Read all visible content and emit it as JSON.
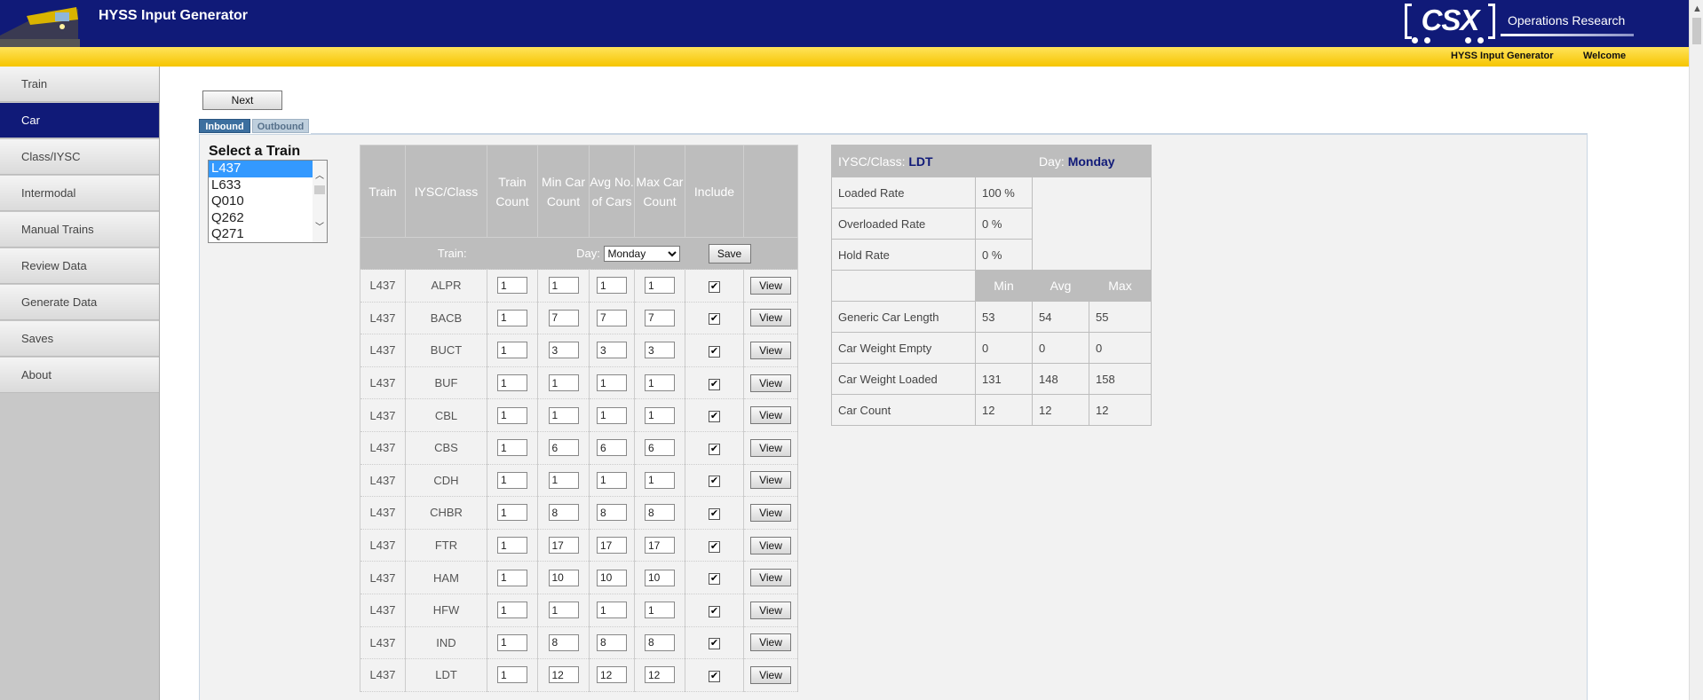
{
  "header": {
    "app_title": "HYSS Input Generator",
    "brand": "CSX",
    "org": "Operations Research",
    "links": [
      "HYSS Input Generator",
      "Welcome"
    ],
    "colors": {
      "header_bg": "#101a78",
      "bar": "#f6c500"
    }
  },
  "sidebar": {
    "items": [
      {
        "label": "Train",
        "active": false
      },
      {
        "label": "Car",
        "active": true
      },
      {
        "label": "Class/IYSC",
        "active": false
      },
      {
        "label": "Intermodal",
        "active": false
      },
      {
        "label": "Manual Trains",
        "active": false
      },
      {
        "label": "Review Data",
        "active": false
      },
      {
        "label": "Generate Data",
        "active": false
      },
      {
        "label": "Saves",
        "active": false
      },
      {
        "label": "About",
        "active": false
      }
    ]
  },
  "main": {
    "next_label": "Next",
    "tabs": [
      {
        "label": "Inbound",
        "active": true
      },
      {
        "label": "Outbound",
        "active": false
      }
    ],
    "select_train_label": "Select a Train",
    "trains": [
      "L437",
      "L633",
      "Q010",
      "Q262",
      "Q271"
    ],
    "selected_train": "L437"
  },
  "car_table": {
    "train_label": "Train:",
    "day_label": "Day:",
    "day_value": "Monday",
    "save_label": "Save",
    "headers": [
      "Train",
      "IYSC/Class",
      "Train Count",
      "Min Car Count",
      "Avg No. of Cars",
      "Max Car Count",
      "Include",
      ""
    ],
    "view_label": "View",
    "rows": [
      {
        "train": "L437",
        "cls": "ALPR",
        "tc": "1",
        "min": "1",
        "avg": "1",
        "max": "1",
        "include": true
      },
      {
        "train": "L437",
        "cls": "BACB",
        "tc": "1",
        "min": "7",
        "avg": "7",
        "max": "7",
        "include": true
      },
      {
        "train": "L437",
        "cls": "BUCT",
        "tc": "1",
        "min": "3",
        "avg": "3",
        "max": "3",
        "include": true
      },
      {
        "train": "L437",
        "cls": "BUF",
        "tc": "1",
        "min": "1",
        "avg": "1",
        "max": "1",
        "include": true
      },
      {
        "train": "L437",
        "cls": "CBL",
        "tc": "1",
        "min": "1",
        "avg": "1",
        "max": "1",
        "include": true
      },
      {
        "train": "L437",
        "cls": "CBS",
        "tc": "1",
        "min": "6",
        "avg": "6",
        "max": "6",
        "include": true
      },
      {
        "train": "L437",
        "cls": "CDH",
        "tc": "1",
        "min": "1",
        "avg": "1",
        "max": "1",
        "include": true
      },
      {
        "train": "L437",
        "cls": "CHBR",
        "tc": "1",
        "min": "8",
        "avg": "8",
        "max": "8",
        "include": true
      },
      {
        "train": "L437",
        "cls": "FTR",
        "tc": "1",
        "min": "17",
        "avg": "17",
        "max": "17",
        "include": true
      },
      {
        "train": "L437",
        "cls": "HAM",
        "tc": "1",
        "min": "10",
        "avg": "10",
        "max": "10",
        "include": true
      },
      {
        "train": "L437",
        "cls": "HFW",
        "tc": "1",
        "min": "1",
        "avg": "1",
        "max": "1",
        "include": true
      },
      {
        "train": "L437",
        "cls": "IND",
        "tc": "1",
        "min": "8",
        "avg": "8",
        "max": "8",
        "include": true
      },
      {
        "train": "L437",
        "cls": "LDT",
        "tc": "1",
        "min": "12",
        "avg": "12",
        "max": "12",
        "include": true
      }
    ]
  },
  "info": {
    "class_label": "IYSC/Class:",
    "class_value": "LDT",
    "day_label": "Day:",
    "day_value": "Monday",
    "rates": [
      {
        "label": "Loaded Rate",
        "value": "100 %"
      },
      {
        "label": "Overloaded Rate",
        "value": "0 %"
      },
      {
        "label": "Hold Rate",
        "value": "0 %"
      }
    ],
    "stat_headers": [
      "Min",
      "Avg",
      "Max"
    ],
    "stats": [
      {
        "label": "Generic Car Length",
        "min": "53",
        "avg": "54",
        "max": "55"
      },
      {
        "label": "Car Weight Empty",
        "min": "0",
        "avg": "0",
        "max": "0"
      },
      {
        "label": "Car Weight Loaded",
        "min": "131",
        "avg": "148",
        "max": "158"
      },
      {
        "label": "Car Count",
        "min": "12",
        "avg": "12",
        "max": "12"
      }
    ]
  }
}
